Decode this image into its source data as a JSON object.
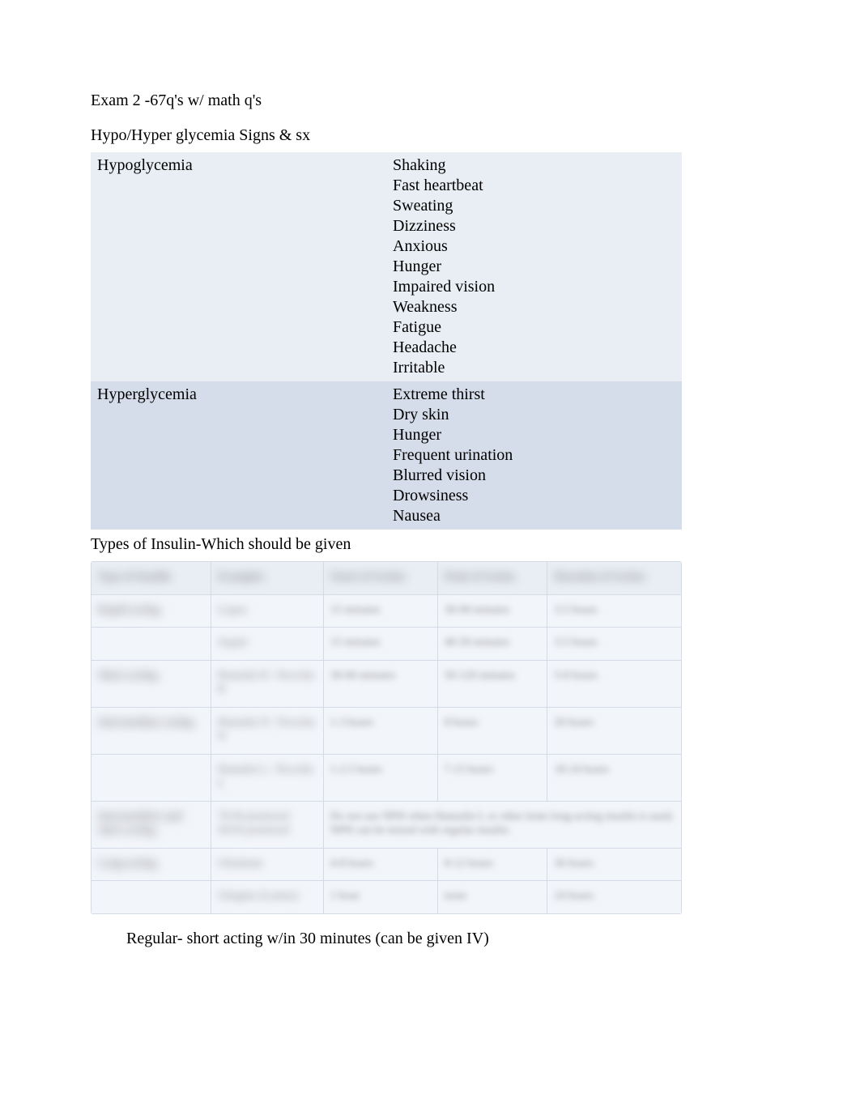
{
  "title_line": "Exam 2 -67q's w/ math q's",
  "section1_heading": "Hypo/Hyper glycemia Signs & sx",
  "glycemia_table": [
    {
      "label": "Hypoglycemia",
      "items": [
        "Shaking",
        "Fast heartbeat",
        "Sweating",
        "Dizziness",
        "Anxious",
        "Hunger",
        "Impaired vision",
        "Weakness",
        "Fatigue",
        "Headache",
        "Irritable"
      ]
    },
    {
      "label": "Hyperglycemia",
      "items": [
        "Extreme thirst",
        "Dry skin",
        "Hunger",
        "Frequent urination",
        "Blurred vision",
        "Drowsiness",
        "Nausea"
      ]
    }
  ],
  "section2_heading": "Types of Insulin-Which should be given",
  "insulin_table": {
    "headers": [
      "Type of Insulin",
      "Examples",
      "Onset of Action",
      "Peak of Action",
      "Duration of Action"
    ],
    "rows": [
      {
        "cat": "Rapid acting",
        "cells": [
          "Lispro",
          "15 minutes",
          "30-90 minutes",
          "3-5 hours"
        ]
      },
      {
        "cat": "",
        "cells": [
          "Aspart",
          "15 minutes",
          "40-50 minutes",
          "3-5 hours"
        ]
      },
      {
        "cat": "Short acting",
        "cells": [
          "Humulin R / Novolin R",
          "30-60 minutes",
          "50-120 minutes",
          "5-8 hours"
        ]
      },
      {
        "cat": "Intermediate acting",
        "cells": [
          "Humulin N / Novolin N",
          "1-3 hours",
          "8 hours",
          "20 hours"
        ]
      },
      {
        "cat": "",
        "cells": [
          "Humulin L / Novolin L",
          "1-2.5 hours",
          "7-15 hours",
          "18-24 hours"
        ]
      },
      {
        "cat": "Intermediate and short acting",
        "cells": [
          "70/30 premixed 50/50 premixed",
          "Do not use NPH when Humulin L or other lente long-acting insulin is used; NPH can be mixed with regular insulin.",
          "",
          ""
        ],
        "span_note": true
      },
      {
        "cat": "Long-acting",
        "cells": [
          "Ultralente",
          "4-8 hours",
          "8-12 hours",
          "36 hours"
        ]
      },
      {
        "cat": "",
        "cells": [
          "Glargine (Lantus)",
          "1 hour",
          "none",
          "24 hours"
        ]
      }
    ]
  },
  "bullet": {
    "glyph": "",
    "text": "Regular- short acting w/in 30 minutes (can be given IV)"
  }
}
